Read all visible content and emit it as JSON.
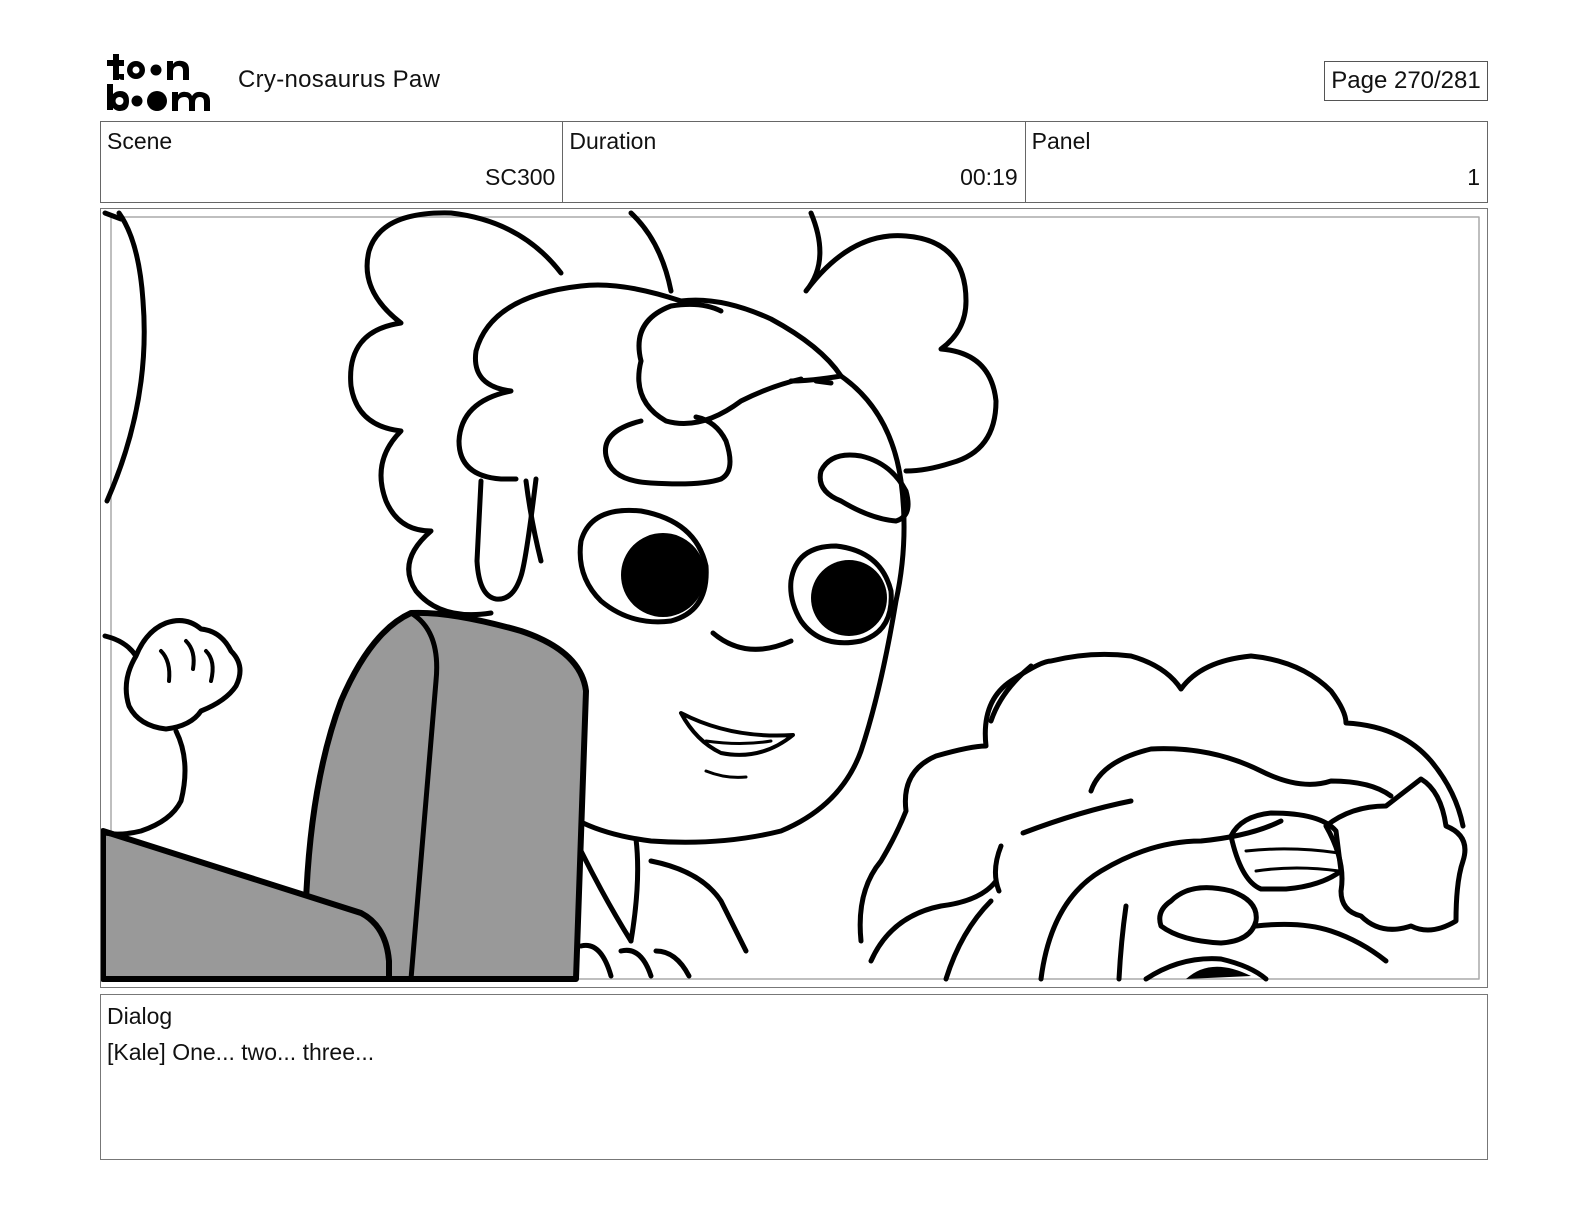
{
  "header": {
    "logo_line1": "toon",
    "logo_line2": "boom",
    "project_title": "Cry-nosaurus Paw",
    "page_indicator": "Page 270/281"
  },
  "info": {
    "scene_label": "Scene",
    "scene_value": "SC300",
    "duration_label": "Duration",
    "duration_value": "00:19",
    "panel_label": "Panel",
    "panel_value": "1"
  },
  "dialog": {
    "label": "Dialog",
    "text": "[Kale] One... two... three..."
  },
  "colors": {
    "ink": "#000000",
    "shade": "#999999",
    "border": "#777777"
  }
}
